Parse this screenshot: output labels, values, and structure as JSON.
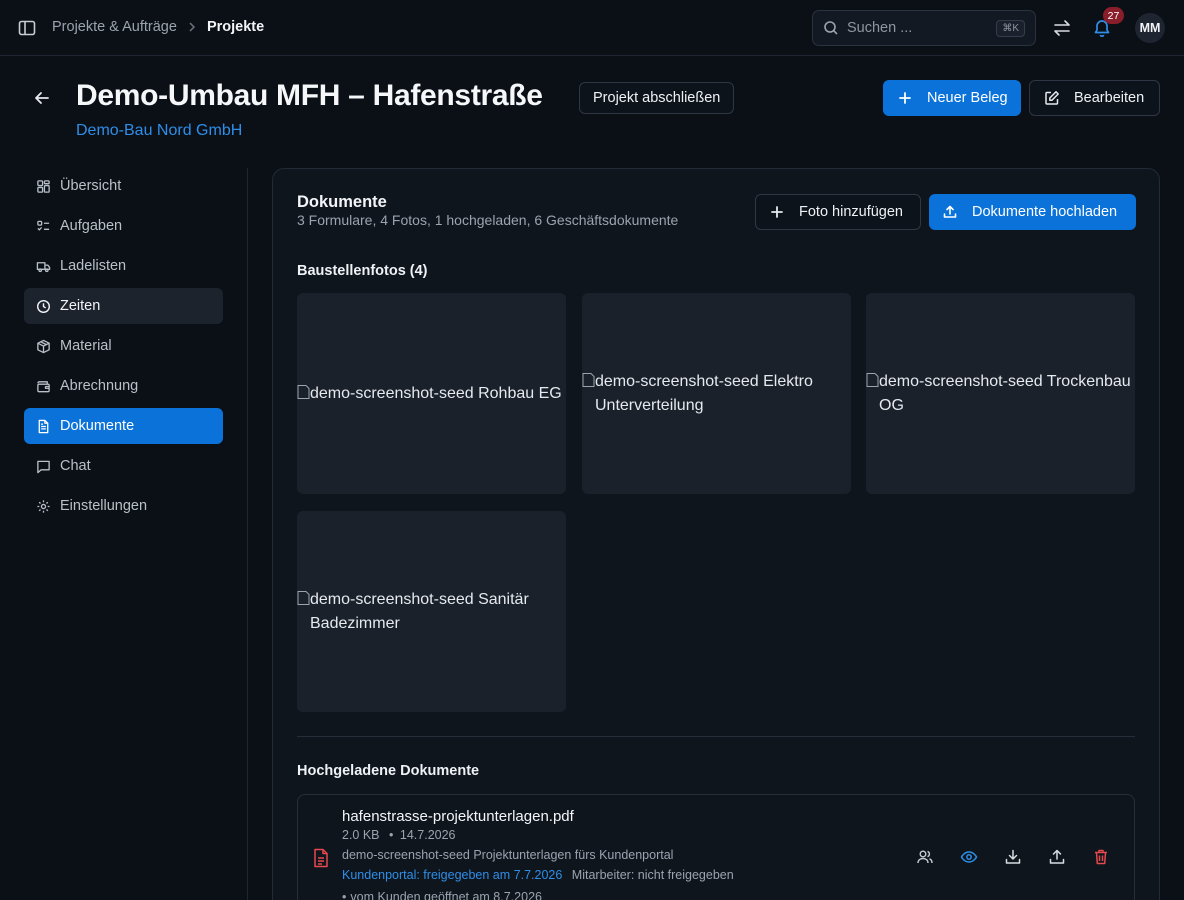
{
  "topbar": {
    "breadcrumb": {
      "parent": "Projekte & Aufträge",
      "current": "Projekte"
    },
    "search": {
      "placeholder": "Suchen ...",
      "shortcut": "⌘K"
    },
    "notifications": {
      "count": "27"
    },
    "user": {
      "initials": "MM"
    }
  },
  "header": {
    "title": "Demo-Umbau MFH – Hafenstraße",
    "customer": "Demo-Bau Nord GmbH",
    "close_project_label": "Projekt abschließen",
    "new_document_label": "Neuer Beleg",
    "edit_label": "Bearbeiten"
  },
  "sidebar": {
    "items": [
      {
        "label": "Übersicht",
        "icon": "dashboard-icon"
      },
      {
        "label": "Aufgaben",
        "icon": "task-list-icon"
      },
      {
        "label": "Ladelisten",
        "icon": "truck-icon"
      },
      {
        "label": "Zeiten",
        "icon": "clock-icon",
        "state": "hover"
      },
      {
        "label": "Material",
        "icon": "package-icon"
      },
      {
        "label": "Abrechnung",
        "icon": "wallet-icon"
      },
      {
        "label": "Dokumente",
        "icon": "document-icon",
        "state": "active"
      },
      {
        "label": "Chat",
        "icon": "chat-icon"
      },
      {
        "label": "Einstellungen",
        "icon": "gear-icon"
      }
    ]
  },
  "documents": {
    "title": "Dokumente",
    "summary": "3 Formulare, 4 Fotos, 1 hochgeladen, 6 Geschäftsdokumente",
    "add_photo_label": "Foto hinzufügen",
    "upload_label": "Dokumente hochladen",
    "photos_title": "Baustellenfotos (4)",
    "photos": [
      {
        "alt": "demo-screenshot-seed Rohbau EG"
      },
      {
        "alt": "demo-screenshot-seed Elektro Unterverteilung"
      },
      {
        "alt": "demo-screenshot-seed Trockenbau OG"
      },
      {
        "alt": "demo-screenshot-seed Sanitär Badezimmer"
      }
    ],
    "uploaded_title": "Hochgeladene Dokumente",
    "uploaded": [
      {
        "name": "hafenstrasse-projektunterlagen.pdf",
        "size": "2.0 KB",
        "date": "14.7.2026",
        "description": "demo-screenshot-seed Projektunterlagen fürs Kundenportal",
        "portal_status": "Kundenportal: freigegeben am 7.7.2026",
        "staff_status": "Mitarbeiter: nicht freigegeben",
        "opened": "vom Kunden geöffnet am 8.7.2026"
      }
    ]
  },
  "colors": {
    "accent": "#0a72d8",
    "danger": "#e5484d",
    "link": "#2e8ee8",
    "background": "#0b1017"
  }
}
